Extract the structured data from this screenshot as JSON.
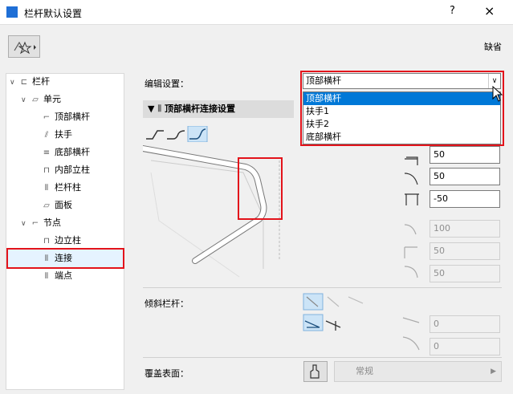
{
  "window": {
    "title": "栏杆默认设置",
    "help": "?",
    "close": "×"
  },
  "toolbar": {
    "default_label": "缺省"
  },
  "tree": [
    {
      "label": "栏杆"
    },
    {
      "label": "单元"
    },
    {
      "label": "顶部横杆"
    },
    {
      "label": "扶手"
    },
    {
      "label": "底部横杆"
    },
    {
      "label": "内部立柱"
    },
    {
      "label": "栏杆柱"
    },
    {
      "label": "面板"
    },
    {
      "label": "节点"
    },
    {
      "label": "边立柱"
    },
    {
      "label": "连接"
    },
    {
      "label": "端点"
    }
  ],
  "edit": {
    "label": "编辑设置：",
    "value": "顶部横杆",
    "options": [
      "顶部横杆",
      "扶手1",
      "扶手2",
      "底部横杆"
    ]
  },
  "section": {
    "title": "顶部横杆连接设置"
  },
  "fields": {
    "f1": "50",
    "f2": "50",
    "f3": "-50",
    "f4": "100",
    "f5": "50",
    "f6": "50"
  },
  "incline": {
    "label": "倾斜栏杆：",
    "f1": "0",
    "f2": "0"
  },
  "surface": {
    "label": "覆盖表面：",
    "value": "常规"
  }
}
